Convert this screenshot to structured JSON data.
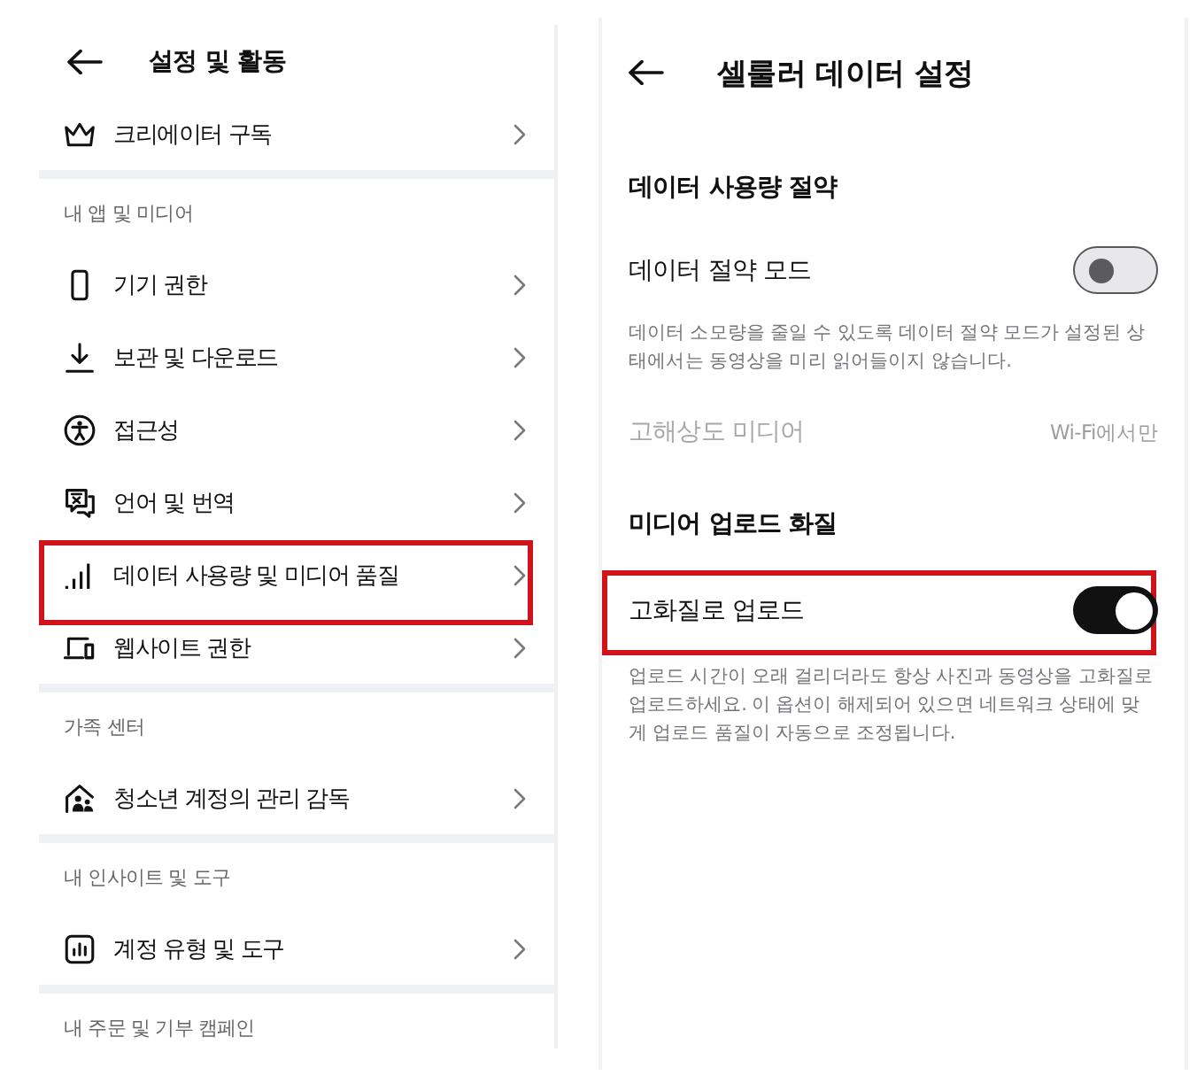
{
  "settings_menu": {
    "title": "설정 및 활동",
    "groups": [
      {
        "items": [
          {
            "label": "크리에이터 구독",
            "highlighted": false
          }
        ]
      },
      {
        "label": "내 앱 및 미디어",
        "items": [
          {
            "label": "기기 권한",
            "highlighted": false
          },
          {
            "label": "보관 및 다운로드",
            "highlighted": false
          },
          {
            "label": "접근성",
            "highlighted": false
          },
          {
            "label": "언어 및 번역",
            "highlighted": false
          },
          {
            "label": "데이터 사용량 및 미디어 품질",
            "highlighted": true
          },
          {
            "label": "웹사이트 권한",
            "highlighted": false
          }
        ]
      },
      {
        "label": "가족 센터",
        "items": [
          {
            "label": "청소년 계정의 관리 감독",
            "highlighted": false
          }
        ]
      },
      {
        "label": "내 인사이트 및 도구",
        "items": [
          {
            "label": "계정 유형 및 도구",
            "highlighted": false
          }
        ]
      },
      {
        "label": "내 주문 및 기부 캠페인"
      }
    ]
  },
  "cellular_settings": {
    "title": "셀룰러 데이터 설정",
    "sections": [
      {
        "heading": "데이터 사용량 절약",
        "rows": [
          {
            "kind": "toggle",
            "label": "데이터 절약 모드",
            "on": false,
            "highlighted": false
          },
          {
            "kind": "note",
            "text": "데이터 소모량을 줄일 수 있도록 데이터 절약 모드가 설정된 상태에서는 동영상을 미리 읽어들이지 않습니다."
          },
          {
            "kind": "value",
            "label": "고해상도 미디어",
            "value": "Wi-Fi에서만",
            "disabled": true
          }
        ]
      },
      {
        "heading": "미디어 업로드 화질",
        "rows": [
          {
            "kind": "toggle",
            "label": "고화질로 업로드",
            "on": true,
            "highlighted": true
          },
          {
            "kind": "note",
            "text": "업로드 시간이 오래 걸리더라도 항상 사진과 동영상을 고화질로 업로드하세요. 이 옵션이 해제되어 있으면 네트워크 상태에 맞게 업로드 품질이 자동으로 조정됩니다."
          }
        ]
      }
    ]
  }
}
